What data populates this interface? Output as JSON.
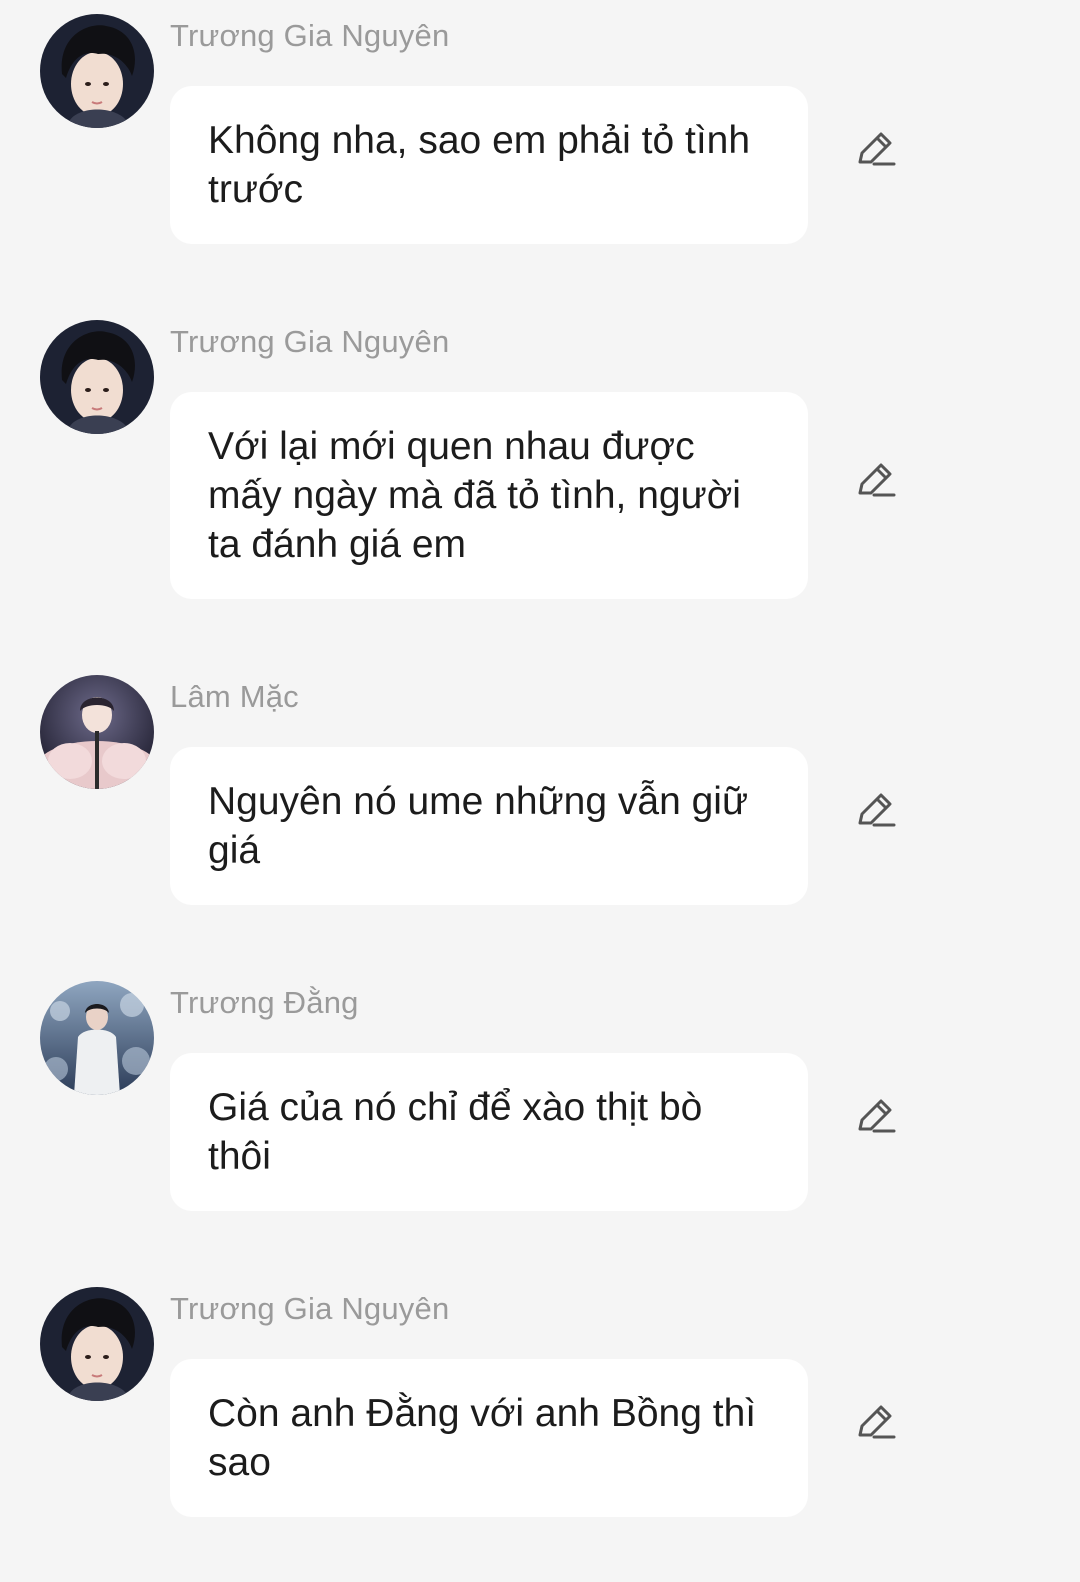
{
  "messages": [
    {
      "sender": "Trương Gia Nguyên",
      "avatar_icon": "avatar-portrait-dark-hair",
      "text": "Không nha, sao em phải tỏ tình trước",
      "edit_icon": "pencil-icon"
    },
    {
      "sender": "Trương Gia Nguyên",
      "avatar_icon": "avatar-portrait-dark-hair",
      "text": "Với lại mới quen nhau được mấy ngày mà đã tỏ tình, người ta đánh giá em",
      "edit_icon": "pencil-icon"
    },
    {
      "sender": "Lâm Mặc",
      "avatar_icon": "avatar-stage-performer",
      "text": "Nguyên nó ume những vẫn giữ giá",
      "edit_icon": "pencil-icon"
    },
    {
      "sender": "Trương Đằng",
      "avatar_icon": "avatar-white-jacket-snow",
      "text": "Giá của nó chỉ để xào thịt bò thôi",
      "edit_icon": "pencil-icon"
    },
    {
      "sender": "Trương Gia Nguyên",
      "avatar_icon": "avatar-portrait-dark-hair",
      "text": "Còn anh Đằng với anh Bồng thì sao",
      "edit_icon": "pencil-icon"
    }
  ],
  "colors": {
    "background": "#f5f5f5",
    "bubble": "#ffffff",
    "sender_name": "#9a9a9a",
    "message_text": "#1c1c1c",
    "icon": "#555555"
  }
}
